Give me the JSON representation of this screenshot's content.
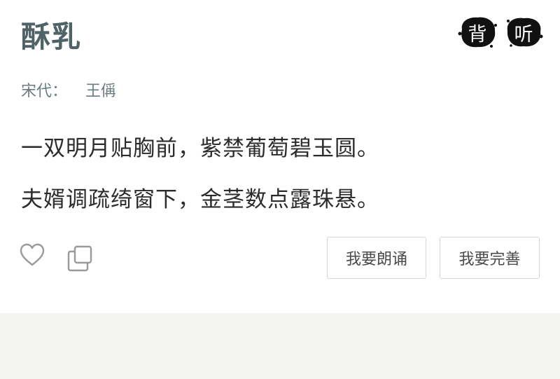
{
  "poem": {
    "title": "酥乳",
    "dynasty": "宋代：",
    "author": "王偁",
    "lines": [
      "一双明月贴胸前，紫禁葡萄碧玉圆。",
      "夫婿调疏绮窗下，金茎数点露珠悬。"
    ]
  },
  "header_buttons": {
    "recite": "背",
    "listen": "听"
  },
  "actions": {
    "like_icon": "heart-outline-icon",
    "copy_icon": "copy-icon",
    "read_aloud": "我要朗诵",
    "improve": "我要完善"
  },
  "colors": {
    "title": "#4e6268",
    "meta": "#6b7c80",
    "text": "#2b2b2b",
    "ink": "#111111",
    "footer_band": "#f4f5f2"
  }
}
